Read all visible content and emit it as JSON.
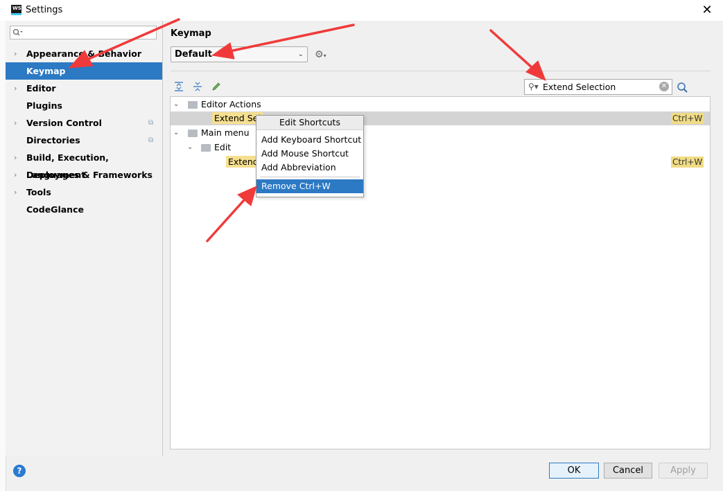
{
  "window": {
    "title": "Settings",
    "app_logo": "WS",
    "close_glyph": "✕"
  },
  "sidebar": {
    "search_placeholder": "",
    "items": [
      {
        "label": "Appearance & Behavior",
        "expandable": true
      },
      {
        "label": "Keymap",
        "selected": true
      },
      {
        "label": "Editor",
        "expandable": true
      },
      {
        "label": "Plugins"
      },
      {
        "label": "Version Control",
        "expandable": true,
        "project_icon": true
      },
      {
        "label": "Directories",
        "project_icon": true
      },
      {
        "label": "Build, Execution, Deployment",
        "expandable": true
      },
      {
        "label": "Languages & Frameworks",
        "expandable": true
      },
      {
        "label": "Tools",
        "expandable": true
      },
      {
        "label": "CodeGlance"
      }
    ]
  },
  "main": {
    "title": "Keymap",
    "keymap_select": "Default",
    "filter_value": "Extend Selection",
    "tree": {
      "editor_actions": "Editor Actions",
      "extend_selection_1": "Extend Sel",
      "shortcut_1": "Ctrl+W",
      "main_menu": "Main menu",
      "edit": "Edit",
      "extend_selection_2": "Extend",
      "shortcut_2": "Ctrl+W"
    }
  },
  "context_menu": {
    "header": "Edit Shortcuts",
    "items": [
      "Add Keyboard Shortcut",
      "Add Mouse Shortcut",
      "Add Abbreviation"
    ],
    "remove": "Remove Ctrl+W"
  },
  "footer": {
    "help": "?",
    "ok": "OK",
    "cancel": "Cancel",
    "apply": "Apply"
  },
  "colors": {
    "selection": "#2c79c4",
    "highlight": "#f5df8f",
    "annotation_arrow": "#f03a3a"
  }
}
